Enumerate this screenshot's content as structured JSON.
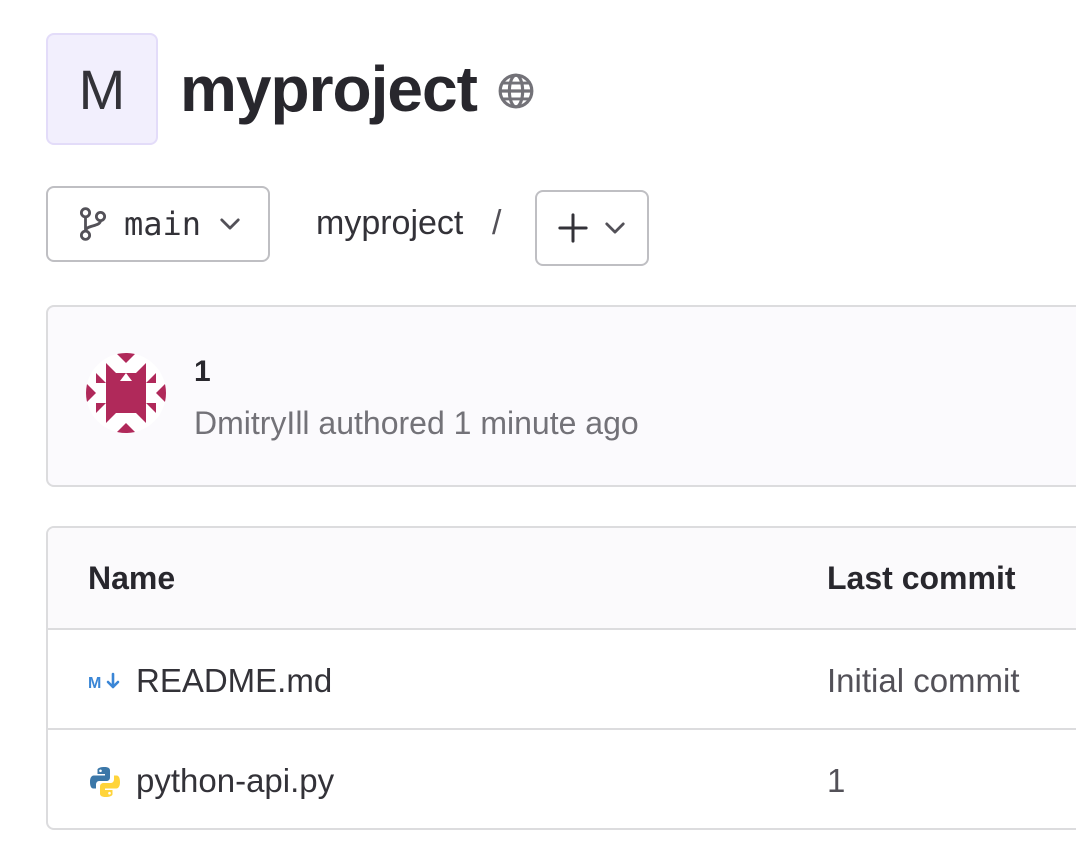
{
  "project": {
    "avatar_letter": "M",
    "name": "myproject",
    "visibility_icon": "globe-icon"
  },
  "toolbar": {
    "branch": "main",
    "breadcrumb_root": "myproject",
    "breadcrumb_separator": "/",
    "add_button_icon": "plus-icon"
  },
  "commit": {
    "title": "1",
    "meta": "DmitryIll authored 1 minute ago",
    "avatar_icon": "identicon-avatar"
  },
  "files": {
    "headers": {
      "name": "Name",
      "last_commit": "Last commit"
    },
    "rows": [
      {
        "icon": "markdown-icon",
        "name": "README.md",
        "last_commit": "Initial commit"
      },
      {
        "icon": "python-icon",
        "name": "python-api.py",
        "last_commit": "1"
      }
    ]
  },
  "colors": {
    "avatar_bg": "#f2effd",
    "identicon": "#b0295a",
    "markdown_blue": "#3a86d6",
    "python_blue": "#3b77a8",
    "python_yellow": "#ffd43b"
  }
}
